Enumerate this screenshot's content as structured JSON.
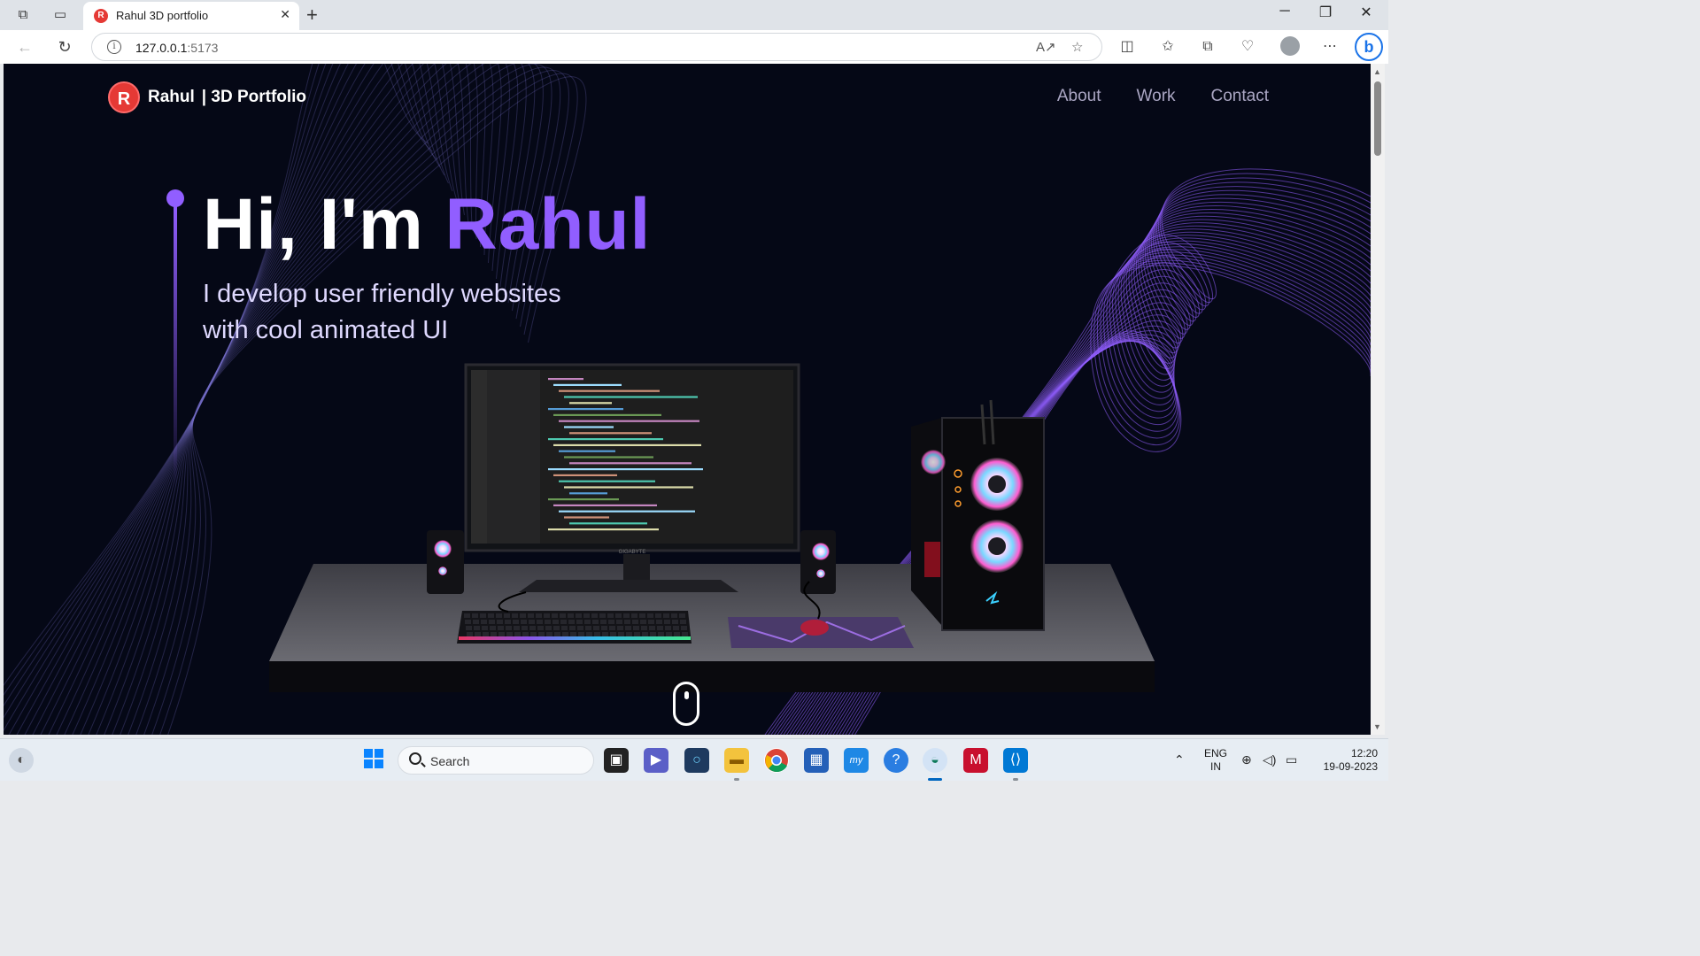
{
  "browser": {
    "tab_title": "Rahul 3D portfolio",
    "tab_favicon_letter": "R",
    "url_host": "127.0.0.1",
    "url_port": ":5173"
  },
  "site": {
    "logo_letter": "R",
    "brand_name": "Rahul",
    "brand_sep": "| 3D Portfolio",
    "nav": [
      {
        "label": "About"
      },
      {
        "label": "Work"
      },
      {
        "label": "Contact"
      }
    ],
    "hero": {
      "greeting": "Hi, I'm ",
      "name": "Rahul",
      "subtitle_line1": "I develop user friendly websites",
      "subtitle_line2": "with cool animated UI"
    },
    "colors": {
      "accent": "#915eff",
      "background": "#050816",
      "nav_text": "#aaa6c3"
    }
  },
  "monitor": {
    "brand_label": "GIGABYTE"
  },
  "taskbar": {
    "search_placeholder": "Search",
    "lang_line1": "ENG",
    "lang_line2": "IN",
    "time": "12:20",
    "date": "19-09-2023",
    "pinned_icons": [
      "windows-start-icon",
      "task-view-icon",
      "teams-chat-icon",
      "cortana-icon",
      "file-explorer-icon",
      "chrome-icon",
      "microsoft-store-icon",
      "myhp-icon",
      "tips-icon",
      "edge-icon",
      "mcafee-icon",
      "vscode-icon"
    ]
  }
}
